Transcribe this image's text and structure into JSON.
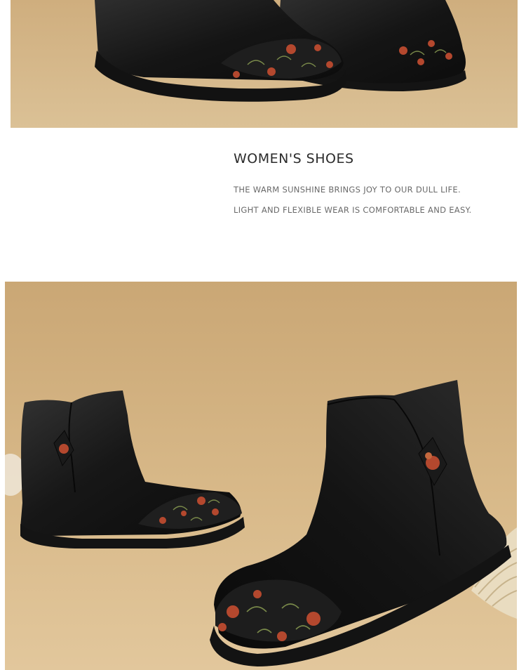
{
  "page": {
    "background": "#ffffff"
  },
  "top_photo": {
    "subject": "black-leather-floral-ankle-boots-closeup"
  },
  "caption": {
    "heading": "WOMEN'S SHOES",
    "line1": "THE WARM SUNSHINE BRINGS JOY TO OUR DULL LIFE.",
    "line2": "LIGHT AND FLEXIBLE WEAR IS COMFORTABLE AND EASY."
  },
  "bottom_photo": {
    "subject": "pair-of-black-leather-floral-ankle-boots"
  },
  "colors": {
    "backdrop": "#d9b98a",
    "leather": "#1a1a1a",
    "flower_red": "#b4482e",
    "flower_green": "#7a8a4a",
    "heading_text": "#2b2b2b",
    "body_text": "#6a6a6a"
  }
}
